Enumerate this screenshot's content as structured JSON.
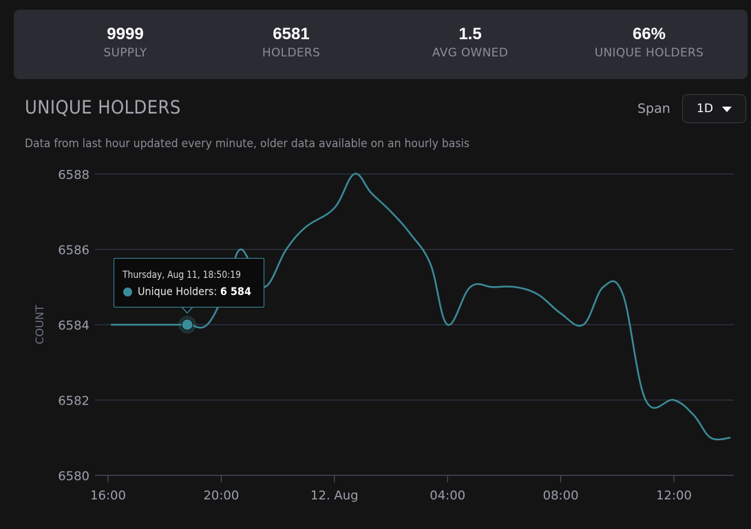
{
  "stats": [
    {
      "value": "9999",
      "label": "SUPPLY"
    },
    {
      "value": "6581",
      "label": "HOLDERS"
    },
    {
      "value": "1.5",
      "label": "AVG OWNED"
    },
    {
      "value": "66%",
      "label": "UNIQUE HOLDERS"
    }
  ],
  "chart_header": {
    "title": "UNIQUE HOLDERS",
    "subtitle": "Data from last hour updated every minute, older data available on an hourly basis",
    "span_label": "Span",
    "span_value": "1D"
  },
  "tooltip": {
    "date": "Thursday, Aug 11, 18:50:19",
    "series": "Unique Holders:",
    "value": "6 584"
  },
  "colors": {
    "line": "#3b8c9a",
    "grid": "#3a3f52",
    "background": "#141415",
    "card": "#2a2b33"
  },
  "chart_data": {
    "type": "line",
    "ylabel": "COUNT",
    "xlabel": "",
    "ylim": [
      6580,
      6588
    ],
    "y_ticks": [
      "6580",
      "6582",
      "6584",
      "6586",
      "6588"
    ],
    "x_ticks": [
      "16:00",
      "20:00",
      "12. Aug",
      "04:00",
      "08:00",
      "12:00"
    ],
    "x_tick_hours": [
      16,
      20,
      24,
      28,
      32,
      36
    ],
    "xlim_hours": [
      16,
      38.0
    ],
    "series": [
      {
        "name": "Unique Holders",
        "x_hours": [
          16.1,
          17.1,
          18.0,
          18.8,
          19.5,
          20.2,
          20.7,
          21.5,
          22.3,
          23.0,
          24.0,
          24.7,
          25.3,
          26.0,
          26.7,
          27.4,
          28.0,
          28.8,
          29.6,
          30.4,
          31.2,
          32.0,
          32.8,
          33.5,
          34.2,
          35.0,
          36.0,
          36.7,
          37.3,
          38.0
        ],
        "values": [
          6584,
          6584,
          6584,
          6584,
          6584,
          6585,
          6586,
          6585,
          6586,
          6586.6,
          6587.1,
          6588,
          6587.5,
          6587,
          6586.4,
          6585.6,
          6584,
          6585,
          6585,
          6585,
          6584.8,
          6584.3,
          6584,
          6585,
          6584.8,
          6582,
          6582,
          6581.6,
          6581,
          6581
        ]
      }
    ],
    "highlight": {
      "x_hours": 18.8,
      "value": 6584
    }
  }
}
